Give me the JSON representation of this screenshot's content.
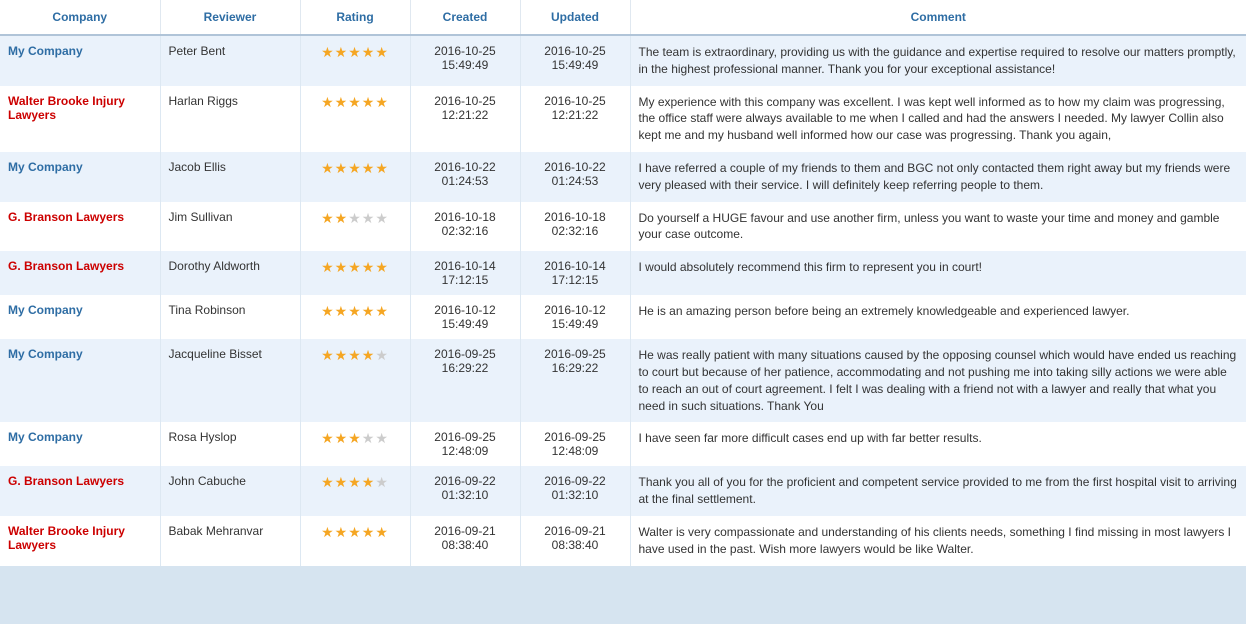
{
  "table": {
    "headers": [
      "Company",
      "Reviewer",
      "Rating",
      "Created",
      "Updated",
      "Comment"
    ],
    "rows": [
      {
        "company": "My Company",
        "company_style": "blue",
        "reviewer": "Peter Bent",
        "rating": 5,
        "created": "2016-10-25\n15:49:49",
        "updated": "2016-10-25\n15:49:49",
        "comment": "The team is extraordinary, providing us with the guidance and expertise required to resolve our matters promptly, in the highest professional manner. Thank you for your exceptional assistance!"
      },
      {
        "company": "Walter Brooke Injury Lawyers",
        "company_style": "red",
        "reviewer": "Harlan Riggs",
        "rating": 5,
        "created": "2016-10-25\n12:21:22",
        "updated": "2016-10-25\n12:21:22",
        "comment": "My experience with this company was excellent. I was kept well informed as to how my claim was progressing, the office staff were always available to me when I called and had the answers I needed. My lawyer Collin also kept me and my husband well informed how our case was progressing. Thank you again,"
      },
      {
        "company": "My Company",
        "company_style": "blue",
        "reviewer": "Jacob Ellis",
        "rating": 5,
        "created": "2016-10-22\n01:24:53",
        "updated": "2016-10-22\n01:24:53",
        "comment": "I have referred a couple of my friends to them and BGC not only contacted them right away but my friends were very pleased with their service. I will definitely keep referring people to them."
      },
      {
        "company": "G. Branson Lawyers",
        "company_style": "red",
        "reviewer": "Jim Sullivan",
        "rating": 2,
        "created": "2016-10-18\n02:32:16",
        "updated": "2016-10-18\n02:32:16",
        "comment": "Do yourself a HUGE favour and use another firm, unless you want to waste your time and money and gamble your case outcome."
      },
      {
        "company": "G. Branson Lawyers",
        "company_style": "red",
        "reviewer": "Dorothy Aldworth",
        "rating": 5,
        "created": "2016-10-14\n17:12:15",
        "updated": "2016-10-14\n17:12:15",
        "comment": "I would absolutely recommend this firm to represent you in court!"
      },
      {
        "company": "My Company",
        "company_style": "blue",
        "reviewer": "Tina Robinson",
        "rating": 5,
        "created": "2016-10-12\n15:49:49",
        "updated": "2016-10-12\n15:49:49",
        "comment": "He is an amazing person before being an extremely knowledgeable and experienced lawyer."
      },
      {
        "company": "My Company",
        "company_style": "blue",
        "reviewer": "Jacqueline Bisset",
        "rating": 4,
        "created": "2016-09-25\n16:29:22",
        "updated": "2016-09-25\n16:29:22",
        "comment": "He was really patient with many situations caused by the opposing counsel which would have ended us reaching to court but because of her patience, accommodating and not pushing me into taking silly actions we were able to reach an out of court agreement. I felt I was dealing with a friend not with a lawyer and really that what you need in such situations. Thank You"
      },
      {
        "company": "My Company",
        "company_style": "blue",
        "reviewer": "Rosa Hyslop",
        "rating": 3,
        "created": "2016-09-25\n12:48:09",
        "updated": "2016-09-25\n12:48:09",
        "comment": "I have seen far more difficult cases end up with far better results."
      },
      {
        "company": "G. Branson Lawyers",
        "company_style": "red",
        "reviewer": "John Cabuche",
        "rating": 4,
        "created": "2016-09-22\n01:32:10",
        "updated": "2016-09-22\n01:32:10",
        "comment": "Thank you all of you for the proficient and competent service provided to me from the first hospital visit to arriving at the final settlement."
      },
      {
        "company": "Walter Brooke Injury Lawyers",
        "company_style": "red",
        "reviewer": "Babak Mehranvar",
        "rating": 5,
        "created": "2016-09-21\n08:38:40",
        "updated": "2016-09-21\n08:38:40",
        "comment": "Walter is very compassionate and understanding of his clients needs, something I find missing in most lawyers I have used in the past. Wish more lawyers would be like Walter."
      }
    ]
  }
}
